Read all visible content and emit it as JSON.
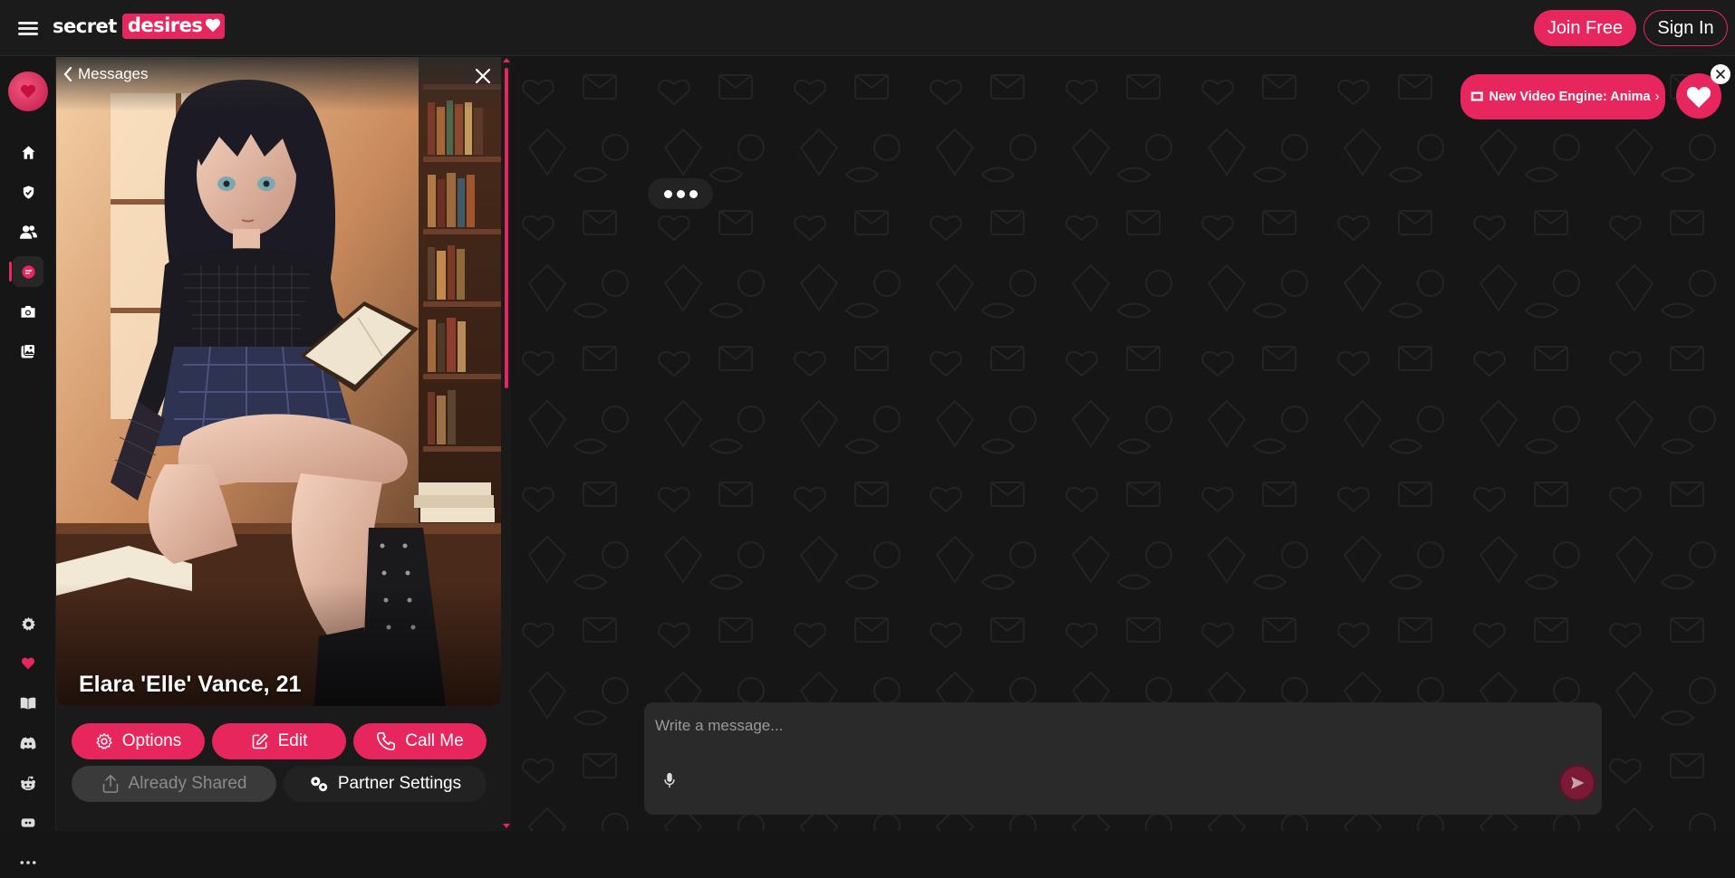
{
  "header": {
    "logo_word1": "secret",
    "logo_word2": "desires",
    "join_label": "Join Free",
    "signin_label": "Sign In"
  },
  "sidebar": {
    "items": [
      {
        "icon": "home-icon"
      },
      {
        "icon": "verified-heart-icon"
      },
      {
        "icon": "users-icon"
      },
      {
        "icon": "chat-icon",
        "active": true
      },
      {
        "icon": "camera-icon"
      },
      {
        "icon": "gallery-icon"
      },
      {
        "icon": "settings-icon"
      },
      {
        "icon": "heart-icon"
      },
      {
        "icon": "book-icon"
      },
      {
        "icon": "discord-icon"
      },
      {
        "icon": "reddit-icon"
      },
      {
        "icon": "controller-icon"
      },
      {
        "icon": "more-icon"
      }
    ]
  },
  "character": {
    "back_label": "Messages",
    "name": "Elara 'Elle' Vance, 21",
    "options_label": "Options",
    "edit_label": "Edit",
    "call_label": "Call Me",
    "shared_label": "Already Shared",
    "partner_settings_label": "Partner Settings"
  },
  "chat": {
    "promo_label": "New Video Engine: Anima",
    "promo_arrow": "›",
    "input_placeholder": "Write a message...",
    "input_value": ""
  },
  "colors": {
    "accent": "#e8265e",
    "background": "#161616",
    "composer": "#2a2a2a"
  }
}
